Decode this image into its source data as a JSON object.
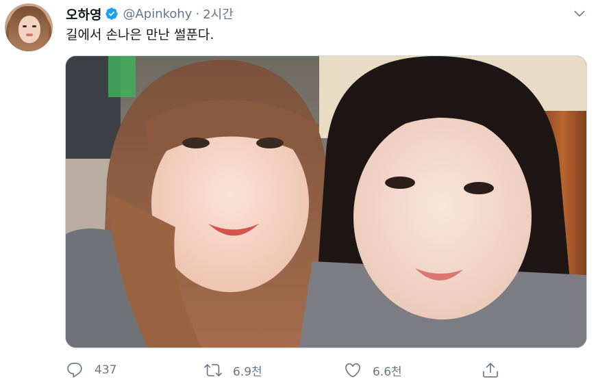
{
  "tweet": {
    "display_name": "오하영",
    "handle": "@Apinkohy",
    "separator": "·",
    "time": "2시간",
    "text": "길에서 손나은 만난 썰푼다."
  },
  "icons": {
    "verified": "verified-badge-icon",
    "more": "chevron-down-icon",
    "reply": "reply-icon",
    "retweet": "retweet-icon",
    "like": "heart-icon",
    "share": "share-icon"
  },
  "stats": {
    "replies": "437",
    "retweets": "6.9천",
    "likes": "6.6천"
  },
  "colors": {
    "accent": "#1da1f2",
    "secondary_text": "#657786",
    "border": "#ccd6dd"
  }
}
